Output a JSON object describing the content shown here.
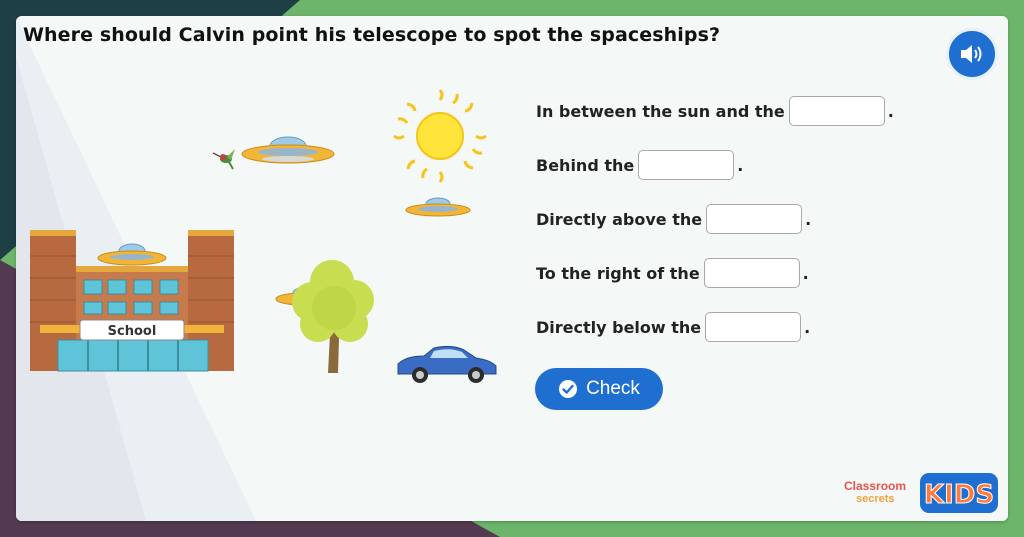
{
  "question": "Where should Calvin point his telescope to spot the spaceships?",
  "audio": {
    "icon": "speaker-icon"
  },
  "scene": {
    "school_sign": "School"
  },
  "answers": [
    {
      "before": "In between the sun and the",
      "after": ".",
      "value": ""
    },
    {
      "before": "Behind the",
      "after": ".",
      "value": ""
    },
    {
      "before": "Directly above the",
      "after": ".",
      "value": ""
    },
    {
      "before": "To the right of the",
      "after": ".",
      "value": ""
    },
    {
      "before": "Directly below the",
      "after": ".",
      "value": ""
    }
  ],
  "check": {
    "label": "Check",
    "icon": "check-circle-icon"
  },
  "logo": {
    "line1": "Classroom",
    "line2": "secrets",
    "kids": "KIDS"
  },
  "colors": {
    "primary": "#1f6fd1",
    "frame_green": "#6cb56a",
    "frame_dark": "#1d3f45"
  }
}
